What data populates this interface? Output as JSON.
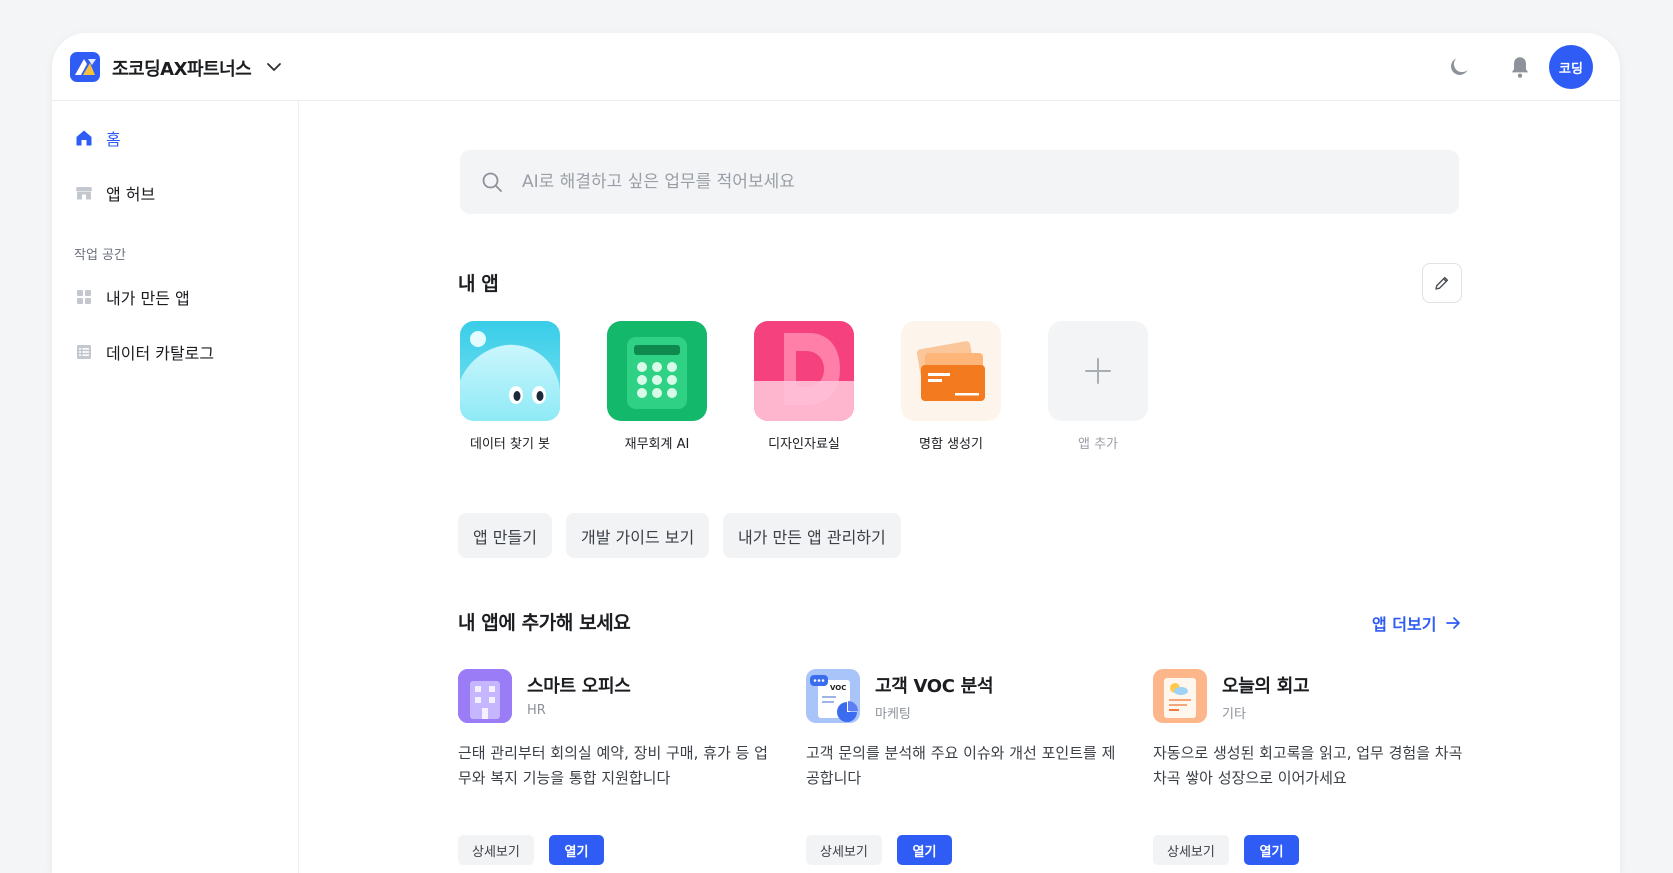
{
  "header": {
    "org_name": "조코딩AX파트너스",
    "avatar_text": "코딩"
  },
  "sidebar": {
    "home": "홈",
    "app_hub": "앱 허브",
    "section_label": "작업 공간",
    "my_apps": "내가 만든 앱",
    "data_catalog": "데이터 카탈로그"
  },
  "search": {
    "placeholder": "AI로 해결하고 싶은 업무를 적어보세요"
  },
  "my_apps": {
    "title": "내 앱",
    "apps": [
      {
        "label": "데이터 찾기 봇",
        "icon": "blob-face-icon"
      },
      {
        "label": "재무회계 AI",
        "icon": "calculator-icon"
      },
      {
        "label": "디자인자료실",
        "icon": "letter-d-icon"
      },
      {
        "label": "명함 생성기",
        "icon": "business-card-icon"
      },
      {
        "label": "앱 추가",
        "icon": "plus-icon"
      }
    ]
  },
  "chips": [
    "앱 만들기",
    "개발 가이드 보기",
    "내가 만든 앱 관리하기"
  ],
  "recommend": {
    "title": "내 앱에 추가해 보세요",
    "more": "앱 더보기",
    "cards": [
      {
        "title": "스마트 오피스",
        "category": "HR",
        "desc": "근태 관리부터 회의실 예약, 장비 구매, 휴가 등 업무와 복지 기능을 통합 지원합니다",
        "detail": "상세보기",
        "open": "열기"
      },
      {
        "title": "고객 VOC 분석",
        "category": "마케팅",
        "desc": "고객 문의를 분석해 주요 이슈와 개선 포인트를 제공합니다",
        "detail": "상세보기",
        "open": "열기",
        "icon_text": "VOC"
      },
      {
        "title": "오늘의 회고",
        "category": "기타",
        "desc": "자동으로 생성된 회고록을 읽고, 업무 경험을 차곡차곡 쌓아 성장으로 이어가세요",
        "detail": "상세보기",
        "open": "열기"
      }
    ]
  },
  "colors": {
    "accent": "#2f5cf5",
    "background": "#f4f5f7"
  }
}
